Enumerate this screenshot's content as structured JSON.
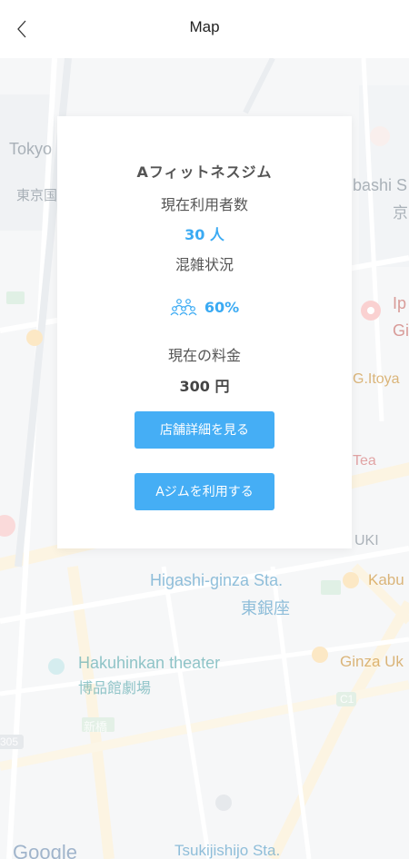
{
  "header": {
    "title": "Map"
  },
  "map": {
    "labels": {
      "tokyo": "Tokyo",
      "tokyo_jp": "東京国",
      "bashi": "bashi S",
      "bashi_jp": "京",
      "ip": "Ip",
      "gi": "Gi",
      "itoya": "G.Itoya",
      "tea": "Tea",
      "uki": "UKI",
      "higashi_ginza": "Higashi-ginza Sta.",
      "higashi_ginza_jp": "東銀座",
      "kabu": "Kabu",
      "hakuhinkan": "Hakuhinkan theater",
      "hakuhinkan_jp": "博品館劇場",
      "ginza_uk": "Ginza Uk",
      "shinbashi_jp": "新橋",
      "c1": "C1",
      "route_305": "305",
      "tsukiji": "Tsukijishijo Sta.",
      "google": "Google"
    }
  },
  "card": {
    "gym_name": "Aフィットネスジム",
    "current_users_label": "現在利用者数",
    "current_users_value": "30 人",
    "congestion_label": "混雑状況",
    "congestion_value": "60%",
    "price_label": "現在の料金",
    "price_value": "300 円",
    "details_button": "店舗詳細を見る",
    "use_button": "Aジムを利用する"
  },
  "colors": {
    "accent": "#45aef5",
    "text": "#555555"
  },
  "icons": {
    "back": "chevron-left-icon",
    "crowd": "people-group-icon"
  }
}
